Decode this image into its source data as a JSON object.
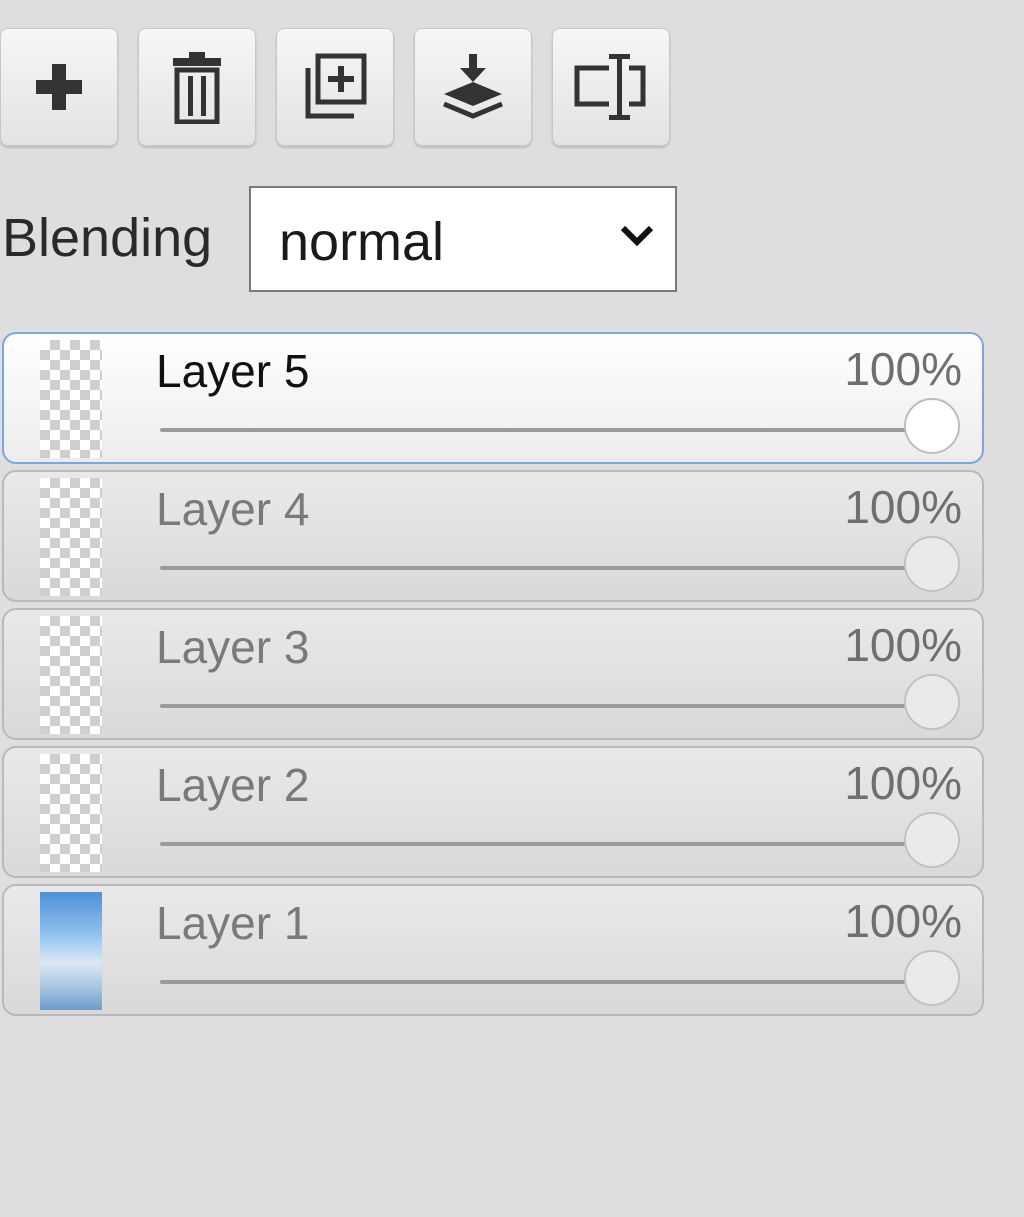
{
  "toolbar": {
    "buttons": [
      {
        "name": "add-layer-button",
        "icon": "plus-icon"
      },
      {
        "name": "delete-layer-button",
        "icon": "trash-icon"
      },
      {
        "name": "duplicate-layer-button",
        "icon": "duplicate-icon"
      },
      {
        "name": "merge-down-button",
        "icon": "merge-down-icon"
      },
      {
        "name": "rename-layer-button",
        "icon": "rename-icon"
      }
    ]
  },
  "blending": {
    "label": "Blending",
    "value": "normal"
  },
  "layers": [
    {
      "name": "Layer 5",
      "opacity_text": "100%",
      "opacity": 1.0,
      "active": true,
      "thumb": "transparent"
    },
    {
      "name": "Layer 4",
      "opacity_text": "100%",
      "opacity": 1.0,
      "active": false,
      "thumb": "transparent"
    },
    {
      "name": "Layer 3",
      "opacity_text": "100%",
      "opacity": 1.0,
      "active": false,
      "thumb": "transparent"
    },
    {
      "name": "Layer 2",
      "opacity_text": "100%",
      "opacity": 1.0,
      "active": false,
      "thumb": "transparent"
    },
    {
      "name": "Layer 1",
      "opacity_text": "100%",
      "opacity": 1.0,
      "active": false,
      "thumb": "photo"
    }
  ],
  "colors": {
    "panel_bg": "#dedede",
    "active_border": "#7aa6e8"
  }
}
